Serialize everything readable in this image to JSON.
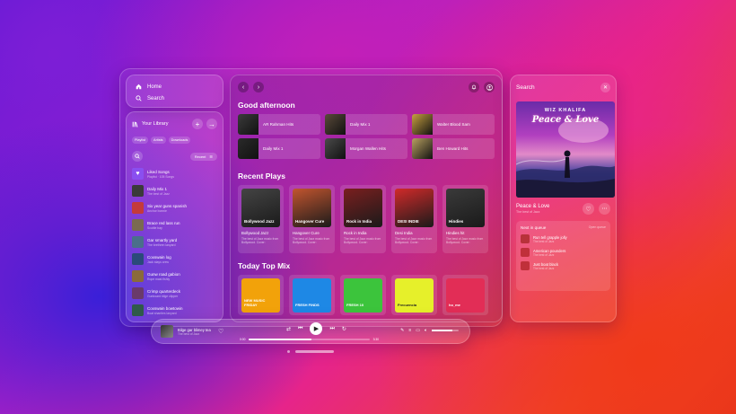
{
  "nav": {
    "home": "Home",
    "search": "Search"
  },
  "library": {
    "title": "Your Library",
    "chips": [
      "Playlist",
      "Artists",
      "Downloads"
    ],
    "sort_label": "Recent",
    "items": [
      {
        "title": "Liked Songs",
        "subtitle": "Playlist · 105 Songs",
        "color": "#8a4ff0"
      },
      {
        "title": "Daily Mix 1",
        "subtitle": "The best of Jazz",
        "color": "#3a3a3a"
      },
      {
        "title": "Six year guns spanish",
        "subtitle": "Anchor bonnie",
        "color": "#c53a3a"
      },
      {
        "title": "Brace red lass run",
        "subtitle": "Scuttle bay",
        "color": "#7a6a50"
      },
      {
        "title": "Gar smartly yard",
        "subtitle": "The brethren lanyard",
        "color": "#4a6f8a"
      },
      {
        "title": "Coxswain log",
        "subtitle": "Jack stays crew",
        "color": "#2a4a7a"
      },
      {
        "title": "Gunw road gabion",
        "subtitle": "Rope mast fishly",
        "color": "#8a6a3a"
      },
      {
        "title": "Crimp quarterdeck",
        "subtitle": "Gunboard bilge clipper",
        "color": "#6a3a6a"
      },
      {
        "title": "Coxswain bowtowin",
        "subtitle": "Boat shanties lanyard",
        "color": "#2f5a4a"
      }
    ]
  },
  "main": {
    "greeting": "Good afternoon",
    "quick": [
      {
        "label": "AR Rahman Hits",
        "color": "#3b3b3b"
      },
      {
        "label": "Daily Mix 1",
        "color": "#5a4a3a"
      },
      {
        "label": "Walter Blood Sam",
        "color": "#c8a040"
      },
      {
        "label": "Daily Mix 1",
        "color": "#2a2a2a"
      },
      {
        "label": "Morgan Wallen Hits",
        "color": "#4a4a4a"
      },
      {
        "label": "Ben Howard Hits",
        "color": "#b8a060"
      }
    ],
    "recent_title": "Recent Plays",
    "recent": [
      {
        "title": "Bollywood Jazz",
        "desc": "The best of Jazz music from Bollywood. Cover:",
        "art_label": "Bollywood Jazz",
        "color": "#444"
      },
      {
        "title": "Hangover Cure",
        "desc": "The best of Jazz music from Bollywood. Cover:",
        "art_label": "Hangover Cure",
        "color": "#c2552f"
      },
      {
        "title": "Rock in India",
        "desc": "The best of Jazz music from Bollywood. Cover:",
        "art_label": "Rock in India",
        "color": "#7a1f1f"
      },
      {
        "title": "Desi India",
        "desc": "The best of Jazz music from Bollywood. Cover:",
        "art_label": "DESI INDIE",
        "color": "#d12a2a"
      },
      {
        "title": "Hindies hit",
        "desc": "The best of Jazz music from Bollywood. Cover:",
        "art_label": "Hindies",
        "color": "#3a3a3a"
      }
    ],
    "mix_title": "Today Top Mix",
    "mixes": [
      {
        "label": "NEW MUSIC FRIDAY",
        "color": "#f2a20a"
      },
      {
        "label": "FRESH FINDS",
        "color": "#1e88e5"
      },
      {
        "label": "FRESH 10",
        "color": "#3cc43c"
      },
      {
        "label": "Frecuencia",
        "color": "#e6f02a"
      },
      {
        "label": "ho_me",
        "color": "#e22d56"
      }
    ]
  },
  "search_panel": {
    "title": "Search",
    "album_artist": "WIZ KHALIFA",
    "album_title": "Peace & Love",
    "song_title": "Peace & Love",
    "song_subtitle": "The best of Jazz",
    "queue_title": "Next in queue",
    "queue_action": "Open queue",
    "queue": [
      {
        "title": "Run tell grapple jolly",
        "subtitle": "The best of Jazz",
        "color": "#b8323a"
      },
      {
        "title": "American pounders",
        "subtitle": "The best of Jazz",
        "color": "#c0303a"
      },
      {
        "title": "Just boat black",
        "subtitle": "The best of Jazz",
        "color": "#c0303a"
      }
    ]
  },
  "player": {
    "title": "Bilge gar blimey tea",
    "subtitle": "The best of Jazz",
    "elapsed": "0:00",
    "total": "3:30",
    "progress": 0.52,
    "volume": 0.75
  }
}
